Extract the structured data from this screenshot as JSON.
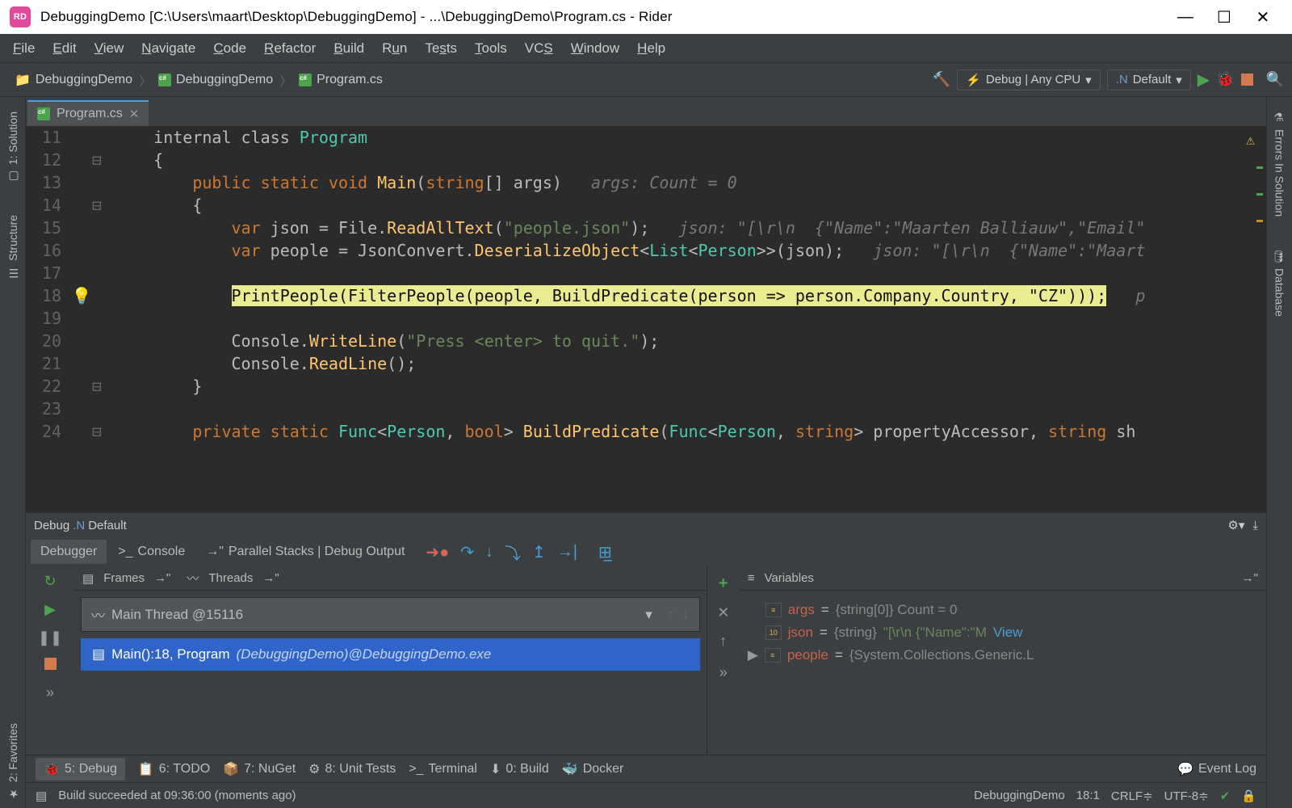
{
  "window": {
    "title": "DebuggingDemo [C:\\Users\\maart\\Desktop\\DebuggingDemo] - ...\\DebuggingDemo\\Program.cs - Rider"
  },
  "menu": [
    "File",
    "Edit",
    "View",
    "Navigate",
    "Code",
    "Refactor",
    "Build",
    "Run",
    "Tests",
    "Tools",
    "VCS",
    "Window",
    "Help"
  ],
  "breadcrumb": [
    "DebuggingDemo",
    "DebuggingDemo",
    "Program.cs"
  ],
  "toolbar": {
    "config_label": "Debug | Any CPU",
    "target_label": "Default"
  },
  "left_tabs": [
    "1: Solution",
    "Structure"
  ],
  "right_tabs": [
    "Errors In Solution",
    "Database"
  ],
  "editor": {
    "tab": "Program.cs",
    "lines": [
      {
        "n": 11,
        "html": "internal class <span class='cl'>Program</span>",
        "fold": ""
      },
      {
        "n": 12,
        "html": "{",
        "fold": "⊟"
      },
      {
        "n": 13,
        "html": "    <span class='kw'>public static void</span> <span class='meth'>Main</span>(<span class='kw'>string</span>[] args)   <span class='hint'>args: Count = 0</span>",
        "fold": ""
      },
      {
        "n": 14,
        "html": "    {",
        "fold": "⊟"
      },
      {
        "n": 15,
        "html": "        <span class='kw'>var</span> json = File.<span class='meth'>ReadAllText</span>(<span class='str'>\"people.json\"</span>);   <span class='hint'>json: \"[\\r\\n  {\"Name\":\"Maarten Balliauw\",\"Email\"</span>",
        "fold": ""
      },
      {
        "n": 16,
        "html": "        <span class='kw'>var</span> people = JsonConvert.<span class='meth'>DeserializeObject</span>&lt;<span class='cl'>List</span>&lt;<span class='cl'>Person</span>&gt;&gt;(json);   <span class='hint'>json: \"[\\r\\n  {\"Name\":\"Maart</span>",
        "fold": ""
      },
      {
        "n": 17,
        "html": "",
        "fold": ""
      },
      {
        "n": 18,
        "html": "        <span class='hlwrap'>PrintPeople(FilterPeople(people, BuildPredicate(person =&gt; person.Company.Country, \"CZ\")));</span>   <span class='hint'>p</span>",
        "fold": "",
        "highlight": true,
        "bulb": true
      },
      {
        "n": 19,
        "html": "",
        "fold": ""
      },
      {
        "n": 20,
        "html": "        Console.<span class='meth'>WriteLine</span>(<span class='str'>\"Press &lt;enter&gt; to quit.\"</span>);",
        "fold": ""
      },
      {
        "n": 21,
        "html": "        Console.<span class='meth'>ReadLine</span>();",
        "fold": ""
      },
      {
        "n": 22,
        "html": "    }",
        "fold": "⊟"
      },
      {
        "n": 23,
        "html": "",
        "fold": ""
      },
      {
        "n": 24,
        "html": "    <span class='kw'>private static</span> <span class='cl'>Func</span>&lt;<span class='cl'>Person</span>, <span class='kw'>bool</span>&gt; <span class='meth'>BuildPredicate</span>(<span class='cl'>Func</span>&lt;<span class='cl'>Person</span>, <span class='kw'>string</span>&gt; propertyAccessor, <span class='kw'>string</span> sh",
        "fold": "⊟"
      }
    ]
  },
  "debug": {
    "header": "Debug",
    "target": "Default",
    "tabs": [
      "Debugger",
      "Console",
      "Parallel Stacks | Debug Output"
    ],
    "frames_label": "Frames",
    "threads_label": "Threads",
    "thread": "Main Thread @15116",
    "frame": "Main():18, Program ",
    "frame_suffix": "(DebuggingDemo)@DebuggingDemo.exe",
    "variables_label": "Variables",
    "vars": [
      {
        "name": "args",
        "sep": " = ",
        "val": "{string[0]} Count = 0",
        "kind": "plain"
      },
      {
        "name": "json",
        "sep": " = ",
        "val": "{string} ",
        "str": "\"[\\r\\n  {\"Name\":\"M",
        "link": "View",
        "kind": "str"
      },
      {
        "name": "people",
        "sep": " = ",
        "val": "{System.Collections.Generic.L",
        "kind": "obj",
        "expand": true
      }
    ]
  },
  "bottom_tabs": [
    {
      "icon": "🐞",
      "label": "5: Debug",
      "active": true
    },
    {
      "icon": "📋",
      "label": "6: TODO"
    },
    {
      "icon": "📦",
      "label": "7: NuGet"
    },
    {
      "icon": "⚙",
      "label": "8: Unit Tests"
    },
    {
      "icon": ">_",
      "label": "Terminal"
    },
    {
      "icon": "⬇",
      "label": "0: Build"
    },
    {
      "icon": "🐳",
      "label": "Docker"
    }
  ],
  "event_log": "Event Log",
  "status": {
    "msg": "Build succeeded at 09:36:00 (moments ago)",
    "project": "DebuggingDemo",
    "pos": "18:1",
    "eol": "CRLF",
    "enc": "UTF-8"
  },
  "favorites_label": "2: Favorites"
}
